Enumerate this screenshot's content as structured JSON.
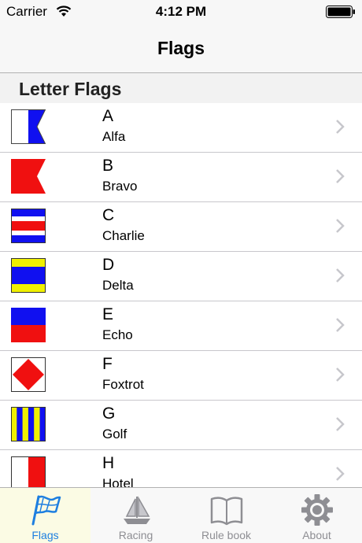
{
  "status_bar": {
    "carrier": "Carrier",
    "time": "4:12 PM"
  },
  "nav": {
    "title": "Flags"
  },
  "section": {
    "title": "Letter Flags"
  },
  "rows": [
    {
      "letter": "A",
      "word": "Alfa"
    },
    {
      "letter": "B",
      "word": "Bravo"
    },
    {
      "letter": "C",
      "word": "Charlie"
    },
    {
      "letter": "D",
      "word": "Delta"
    },
    {
      "letter": "E",
      "word": "Echo"
    },
    {
      "letter": "F",
      "word": "Foxtrot"
    },
    {
      "letter": "G",
      "word": "Golf"
    },
    {
      "letter": "H",
      "word": "Hotel"
    }
  ],
  "tabs": [
    {
      "label": "Flags",
      "icon": "flag-icon",
      "active": true
    },
    {
      "label": "Racing",
      "icon": "sailboat-icon",
      "active": false
    },
    {
      "label": "Rule book",
      "icon": "book-icon",
      "active": false
    },
    {
      "label": "About",
      "icon": "gear-icon",
      "active": false
    }
  ],
  "colors": {
    "accent": "#1e7fe0",
    "flag_blue": "#1010f0",
    "flag_red": "#f01010",
    "flag_yellow": "#f0f000",
    "chevron": "#c7c7cc"
  }
}
